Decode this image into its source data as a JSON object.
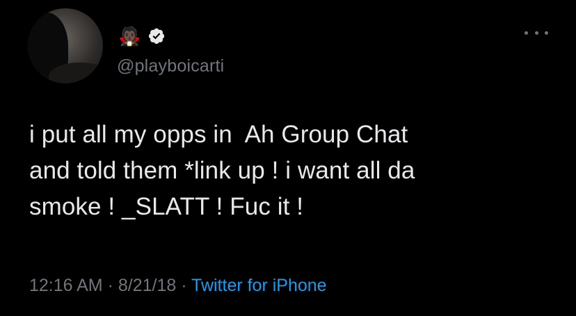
{
  "tweet": {
    "display_name": "🧛🏿",
    "verified": true,
    "handle": "@playboicarti",
    "text": "i put all my opps in  Ah Group Chat\nand told them *link up ! i want all da\nsmoke ! _SLATT ! Fuc it !",
    "time": "12:16 AM",
    "separator": " · ",
    "date": "8/21/18",
    "source": "Twitter for iPhone"
  },
  "icons": {
    "more": "more-horizontal-icon",
    "verified": "verified-badge-icon"
  },
  "colors": {
    "background": "#000000",
    "primary_text": "#e7e9ea",
    "secondary_text": "#71767b",
    "link": "#1d9bf0"
  }
}
